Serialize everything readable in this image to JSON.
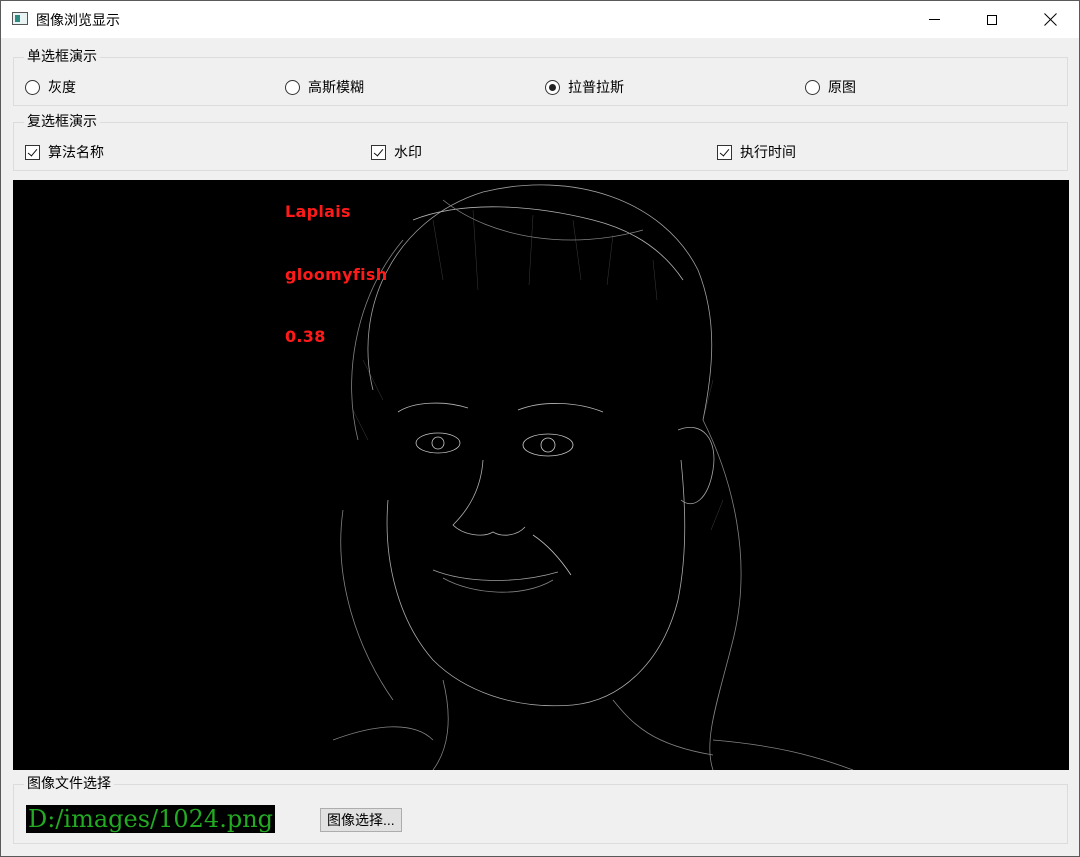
{
  "window": {
    "title": "图像浏览显示"
  },
  "radio_group": {
    "legend": "单选框演示",
    "options": [
      {
        "label": "灰度",
        "checked": false
      },
      {
        "label": "高斯模糊",
        "checked": false
      },
      {
        "label": "拉普拉斯",
        "checked": true
      },
      {
        "label": "原图",
        "checked": false
      }
    ]
  },
  "checkbox_group": {
    "legend": "复选框演示",
    "options": [
      {
        "label": "算法名称",
        "checked": true
      },
      {
        "label": "水印",
        "checked": true
      },
      {
        "label": "执行时间",
        "checked": true
      }
    ]
  },
  "image_view": {
    "overlay": {
      "algorithm": "Laplais",
      "watermark": "gloomyfish",
      "time": "0.38"
    },
    "colors": {
      "overlay_text": "#ff1a1a",
      "background": "#000000"
    }
  },
  "file_group": {
    "legend": "图像文件选择",
    "path": "D:/images/1024.png",
    "button_label": "图像选择...",
    "path_text_color": "#22aa22"
  }
}
